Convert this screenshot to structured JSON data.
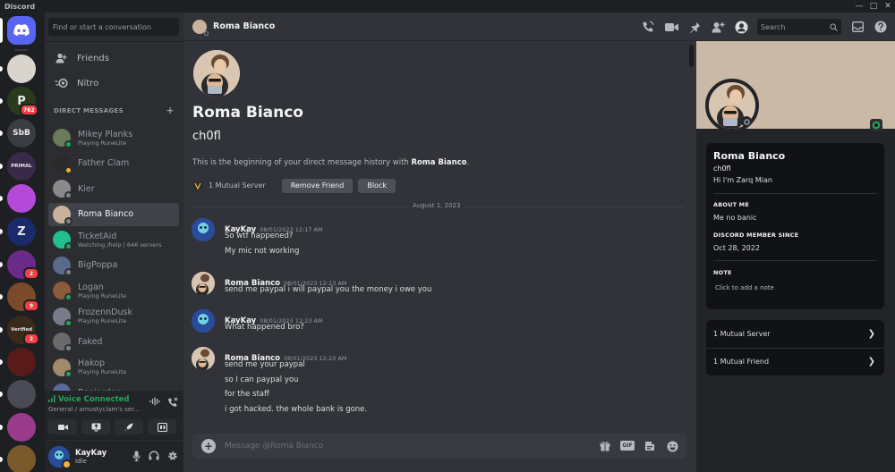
{
  "window": {
    "title": "Discord"
  },
  "colors": {
    "blurple": "#5865f2",
    "online": "#23a55a",
    "idle": "#f0b232",
    "offline": "#80848e",
    "danger": "#f23f43"
  },
  "servers": [
    {
      "abbr": "",
      "color": "#5865f2",
      "home": true
    },
    {
      "abbr": "",
      "color": "#d9d4cc",
      "badge": ""
    },
    {
      "abbr": "P",
      "color": "#2a3a1e",
      "badge": "762"
    },
    {
      "abbr": "SbB",
      "color": "#3a3c42",
      "badge": ""
    },
    {
      "abbr": "PRIMAL",
      "color": "#3a2a4a",
      "badge": ""
    },
    {
      "abbr": "",
      "color": "#b34ad9",
      "badge": ""
    },
    {
      "abbr": "Z",
      "color": "#1a2a6a",
      "badge": ""
    },
    {
      "abbr": "",
      "color": "#6a2a8a",
      "badge": "2"
    },
    {
      "abbr": "",
      "color": "#7a4a2a",
      "badge": "9"
    },
    {
      "abbr": "Verified",
      "color": "#3a2a1a",
      "badge": "2"
    },
    {
      "abbr": "",
      "color": "#5a1a1a",
      "badge": ""
    },
    {
      "abbr": "",
      "color": "#4a4a55",
      "badge": ""
    },
    {
      "abbr": "",
      "color": "#9a3a8a",
      "badge": ""
    },
    {
      "abbr": "",
      "color": "#7a5a2a",
      "badge": ""
    }
  ],
  "sidebar": {
    "search_placeholder": "Find or start a conversation",
    "friends_label": "Friends",
    "nitro_label": "Nitro",
    "dm_header": "DIRECT MESSAGES",
    "dms": [
      {
        "name": "Mikey Planks",
        "sub": "Playing RuneLite",
        "status": "on",
        "color": "#6a7a5a"
      },
      {
        "name": "Father Clam",
        "sub": "",
        "status": "idle",
        "color": "#2a2a2a"
      },
      {
        "name": "Kier",
        "sub": "",
        "status": "off",
        "color": "#8a8a8a"
      },
      {
        "name": "Roma Bianco",
        "sub": "",
        "status": "off",
        "color": "#c9b29a"
      },
      {
        "name": "TicketAid",
        "sub": "Watching /help | 646 servers",
        "status": "on",
        "color": "#1fbf8f"
      },
      {
        "name": "BigPoppa",
        "sub": "",
        "status": "off",
        "color": "#5a6a8a"
      },
      {
        "name": "Logan",
        "sub": "Playing RuneLite",
        "status": "on",
        "color": "#8a5a3a"
      },
      {
        "name": "FrozennDusk",
        "sub": "Playing RuneLite",
        "status": "on",
        "color": "#7a7a8a"
      },
      {
        "name": "Faked",
        "sub": "",
        "status": "off",
        "color": "#6a6a6a"
      },
      {
        "name": "Hakop",
        "sub": "Playing RuneLite",
        "status": "on",
        "color": "#a08a6a"
      },
      {
        "name": "Benjerdog",
        "sub": "",
        "status": "off",
        "color": "#5a6a9a"
      }
    ]
  },
  "voice": {
    "status": "Voice Connected",
    "channel": "General / amustyclam's ser..."
  },
  "user": {
    "name": "KayKay",
    "status": "Idle"
  },
  "header": {
    "title": "Roma Bianco",
    "search_placeholder": "Search"
  },
  "intro": {
    "name": "Roma Bianco",
    "username": "ch0fl",
    "text_before": "This is the beginning of your direct message history with ",
    "text_name": "Roma Bianco",
    "text_after": ".",
    "mutual": "1 Mutual Server",
    "remove_label": "Remove Friend",
    "block_label": "Block"
  },
  "date_divider": "August 1, 2023",
  "messages": [
    {
      "author": "KayKay",
      "time": "08/01/2023 12:17 AM",
      "lines": [
        "So wtf happened?",
        "My mic not working"
      ],
      "color": "#1f6fd0"
    },
    {
      "author": "Roma Bianco",
      "time": "08/01/2023 12:23 AM",
      "lines": [
        "send me paypal i will paypal you the money i owe you"
      ],
      "color": "#c9b29a"
    },
    {
      "author": "KayKay",
      "time": "08/01/2023 12:23 AM",
      "lines": [
        "What happened bro?"
      ],
      "color": "#1f6fd0"
    },
    {
      "author": "Roma Bianco",
      "time": "08/01/2023 12:23 AM",
      "lines": [
        "send me your paypal",
        "so I can paypal you",
        "for the staff",
        "i got hacked. the whole bank is gone."
      ],
      "color": "#c9b29a"
    }
  ],
  "composer": {
    "placeholder": "Message @Roma Bianco",
    "gif_label": "GIF"
  },
  "profile": {
    "name": "Roma Bianco",
    "username": "ch0fl",
    "bio": "Hi I'm Zarq Mian",
    "about_header": "ABOUT ME",
    "about": "Me no banic",
    "since_header": "DISCORD MEMBER SINCE",
    "since": "Oct 28, 2022",
    "note_header": "NOTE",
    "note_placeholder": "Click to add a note",
    "mutual_server": "1 Mutual Server",
    "mutual_friend": "1 Mutual Friend"
  }
}
